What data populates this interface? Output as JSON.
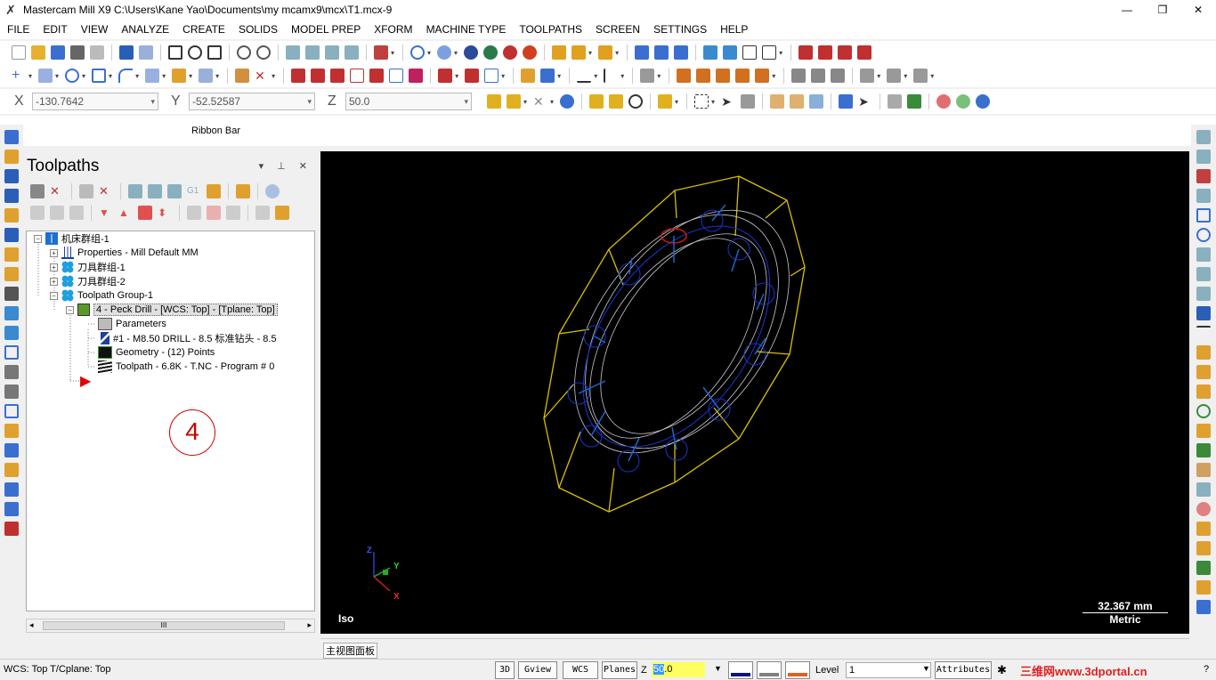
{
  "window": {
    "title": "Mastercam Mill X9  C:\\Users\\Kane Yao\\Documents\\my mcamx9\\mcx\\T1.mcx-9",
    "minimize": "—",
    "restore": "❐",
    "close": "✕"
  },
  "menu": [
    "FILE",
    "EDIT",
    "VIEW",
    "ANALYZE",
    "CREATE",
    "SOLIDS",
    "MODEL PREP",
    "XFORM",
    "MACHINE TYPE",
    "TOOLPATHS",
    "SCREEN",
    "SETTINGS",
    "HELP"
  ],
  "coords": {
    "x_label": "X",
    "x_value": "-130.7642",
    "y_label": "Y",
    "y_value": "-52.52587",
    "z_label": "Z",
    "z_value": "50.0"
  },
  "ribbon": {
    "label": "Ribbon Bar"
  },
  "panel": {
    "title": "Toolpaths",
    "controls": "▾ ⊥ ✕",
    "tree": [
      {
        "label": "机床群组-1",
        "indent": 0,
        "expander": "−",
        "icon": "machine-group-icon"
      },
      {
        "label": "Properties - Mill Default MM",
        "indent": 1,
        "expander": "+",
        "icon": "properties-icon"
      },
      {
        "label": "刀具群组-1",
        "indent": 1,
        "expander": "+",
        "icon": "group-icon"
      },
      {
        "label": "刀具群组-2",
        "indent": 1,
        "expander": "+",
        "icon": "group-icon"
      },
      {
        "label": "Toolpath Group-1",
        "indent": 1,
        "expander": "−",
        "icon": "group-icon"
      },
      {
        "label": "4 - Peck Drill - [WCS: Top] - [Tplane: Top]",
        "indent": 2,
        "expander": "−",
        "icon": "operation-folder-icon",
        "selected": true
      },
      {
        "label": "Parameters",
        "indent": 3,
        "expander": "",
        "icon": "parameters-folder-icon"
      },
      {
        "label": "#1 - M8.50 DRILL - 8.5 标准钻头 - 8.5",
        "indent": 3,
        "expander": "",
        "icon": "drill-tool-icon"
      },
      {
        "label": "Geometry - (12) Points",
        "indent": 3,
        "expander": "",
        "icon": "geometry-icon"
      },
      {
        "label": "Toolpath - 6.8K - T.NC - Program # 0",
        "indent": 3,
        "expander": "",
        "icon": "toolpath-icon"
      }
    ],
    "insert_arrow": "▶",
    "scroll_thumb": "III",
    "scroll_left": "◂",
    "scroll_right": "▸"
  },
  "annotation": {
    "badge": "4"
  },
  "viewport": {
    "view_name": "Iso",
    "scale_value": "32.367 mm",
    "scale_unit": "Metric",
    "axis_z": "Z",
    "axis_y": "Y",
    "axis_x": "X"
  },
  "view_tab": {
    "label": "主视图面板"
  },
  "status": {
    "wcs": "WCS: Top  T/Cplane: Top",
    "btn_3d": "3D",
    "btn_gview": "Gview",
    "btn_wcs": "WCS",
    "btn_planes": "Planes",
    "z_label": "Z",
    "z_sel": "50",
    "z_rest": ".0",
    "level_label": "Level",
    "level_value": "1",
    "attributes": "Attributes",
    "star": "✱",
    "watermark": "三维网www.3dportal.cn",
    "help": "?"
  },
  "colors": {
    "accent_blue": "#1e6fd0",
    "wire_yellow": "#d8c000",
    "wire_blue": "#1830c0",
    "wire_white": "#c8c8c8",
    "hole_red": "#d01818",
    "tool_blue": "#1a66d0",
    "badge_red": "#cc0000"
  }
}
